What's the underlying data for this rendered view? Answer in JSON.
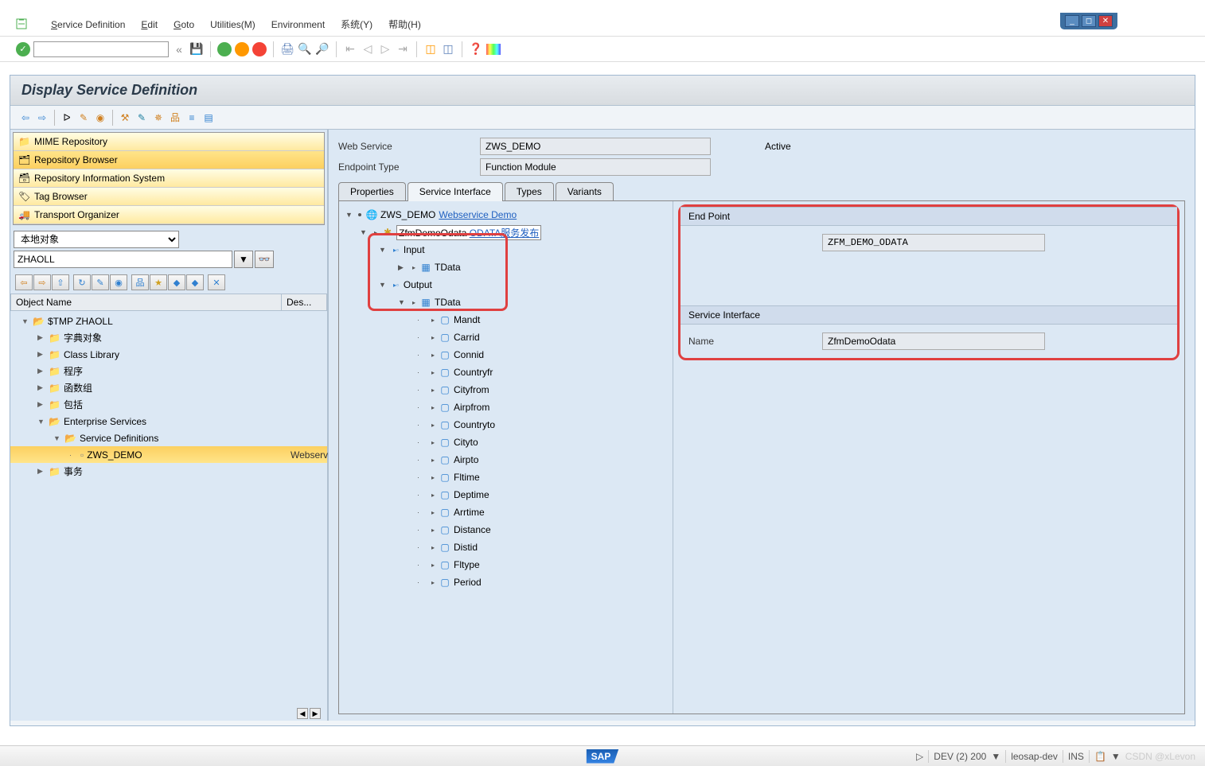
{
  "window": {
    "min": "_",
    "max": "◻",
    "close": "✕"
  },
  "menubar": {
    "items": [
      "Service Definition",
      "Edit",
      "Goto",
      "Utilities(M)",
      "Environment",
      "系统(Y)",
      "帮助(H)"
    ]
  },
  "title": "Display Service Definition",
  "leftnav": {
    "tabs": [
      "MIME Repository",
      "Repository Browser",
      "Repository Information System",
      "Tag Browser",
      "Transport Organizer"
    ],
    "local_select": "本地对象",
    "user": "ZHAOLL",
    "objtable": {
      "col_name": "Object Name",
      "col_desc": "Des..."
    },
    "tree": [
      {
        "lvl": 0,
        "exp": "▼",
        "icon": "folder-open",
        "label": "$TMP ZHAOLL"
      },
      {
        "lvl": 1,
        "exp": "▶",
        "icon": "folder",
        "label": "字典对象"
      },
      {
        "lvl": 1,
        "exp": "▶",
        "icon": "folder",
        "label": "Class Library"
      },
      {
        "lvl": 1,
        "exp": "▶",
        "icon": "folder",
        "label": "程序"
      },
      {
        "lvl": 1,
        "exp": "▶",
        "icon": "folder",
        "label": "函数组"
      },
      {
        "lvl": 1,
        "exp": "▶",
        "icon": "folder",
        "label": "  包括"
      },
      {
        "lvl": 1,
        "exp": "▼",
        "icon": "folder-open",
        "label": "Enterprise Services"
      },
      {
        "lvl": 2,
        "exp": "▼",
        "icon": "folder-open",
        "label": "Service Definitions"
      },
      {
        "lvl": 3,
        "exp": "·",
        "icon": "doc",
        "label": "ZWS_DEMO",
        "selected": true,
        "desc": "Webserv"
      },
      {
        "lvl": 1,
        "exp": "▶",
        "icon": "folder",
        "label": "事务"
      }
    ]
  },
  "right": {
    "ws_label": "Web Service",
    "ws_value": "ZWS_DEMO",
    "status": "Active",
    "et_label": "Endpoint Type",
    "et_value": "Function Module",
    "tabs": [
      "Properties",
      "Service Interface",
      "Types",
      "Variants"
    ],
    "active_tab": 1,
    "svc_tree": [
      {
        "d": 0,
        "exp": "▼",
        "dot": true,
        "icon": "globe",
        "label": "ZWS_DEMO",
        "link": "Webservice Demo"
      },
      {
        "d": 1,
        "exp": "▼",
        "bullet": true,
        "icon": "mod",
        "label": "ZfmDemoOdata",
        "link": "ODATA服务发布",
        "boxed": true
      },
      {
        "d": 2,
        "exp": "▼",
        "io": true,
        "icon": "",
        "label": "Input"
      },
      {
        "d": 3,
        "exp": "▶",
        "bullet": true,
        "icon": "table",
        "label": "TData"
      },
      {
        "d": 2,
        "exp": "▼",
        "io": true,
        "icon": "",
        "label": "Output"
      },
      {
        "d": 3,
        "exp": "▼",
        "bullet": true,
        "icon": "table",
        "label": "TData"
      },
      {
        "d": 4,
        "exp": "·",
        "bullet": true,
        "icon": "field",
        "label": "Mandt"
      },
      {
        "d": 4,
        "exp": "·",
        "bullet": true,
        "icon": "field",
        "label": "Carrid"
      },
      {
        "d": 4,
        "exp": "·",
        "bullet": true,
        "icon": "field",
        "label": "Connid"
      },
      {
        "d": 4,
        "exp": "·",
        "bullet": true,
        "icon": "field",
        "label": "Countryfr"
      },
      {
        "d": 4,
        "exp": "·",
        "bullet": true,
        "icon": "field",
        "label": "Cityfrom"
      },
      {
        "d": 4,
        "exp": "·",
        "bullet": true,
        "icon": "field",
        "label": "Airpfrom"
      },
      {
        "d": 4,
        "exp": "·",
        "bullet": true,
        "icon": "field",
        "label": "Countryto"
      },
      {
        "d": 4,
        "exp": "·",
        "bullet": true,
        "icon": "field",
        "label": "Cityto"
      },
      {
        "d": 4,
        "exp": "·",
        "bullet": true,
        "icon": "field",
        "label": "Airpto"
      },
      {
        "d": 4,
        "exp": "·",
        "bullet": true,
        "icon": "field",
        "label": "Fltime"
      },
      {
        "d": 4,
        "exp": "·",
        "bullet": true,
        "icon": "field",
        "label": "Deptime"
      },
      {
        "d": 4,
        "exp": "·",
        "bullet": true,
        "icon": "field",
        "label": "Arrtime"
      },
      {
        "d": 4,
        "exp": "·",
        "bullet": true,
        "icon": "field",
        "label": "Distance"
      },
      {
        "d": 4,
        "exp": "·",
        "bullet": true,
        "icon": "field",
        "label": "Distid"
      },
      {
        "d": 4,
        "exp": "·",
        "bullet": true,
        "icon": "field",
        "label": "Fltype"
      },
      {
        "d": 4,
        "exp": "·",
        "bullet": true,
        "icon": "field",
        "label": "Period"
      }
    ],
    "detail": {
      "ep_header": "End Point",
      "ep_value": "ZFM_DEMO_ODATA",
      "si_header": "Service Interface",
      "si_name_label": "Name",
      "si_name_value": "ZfmDemoOdata"
    }
  },
  "statusbar": {
    "sap": "SAP",
    "sys": "DEV (2) 200",
    "host": "leosap-dev",
    "mode": "INS",
    "watermark": "CSDN @xLevon"
  }
}
